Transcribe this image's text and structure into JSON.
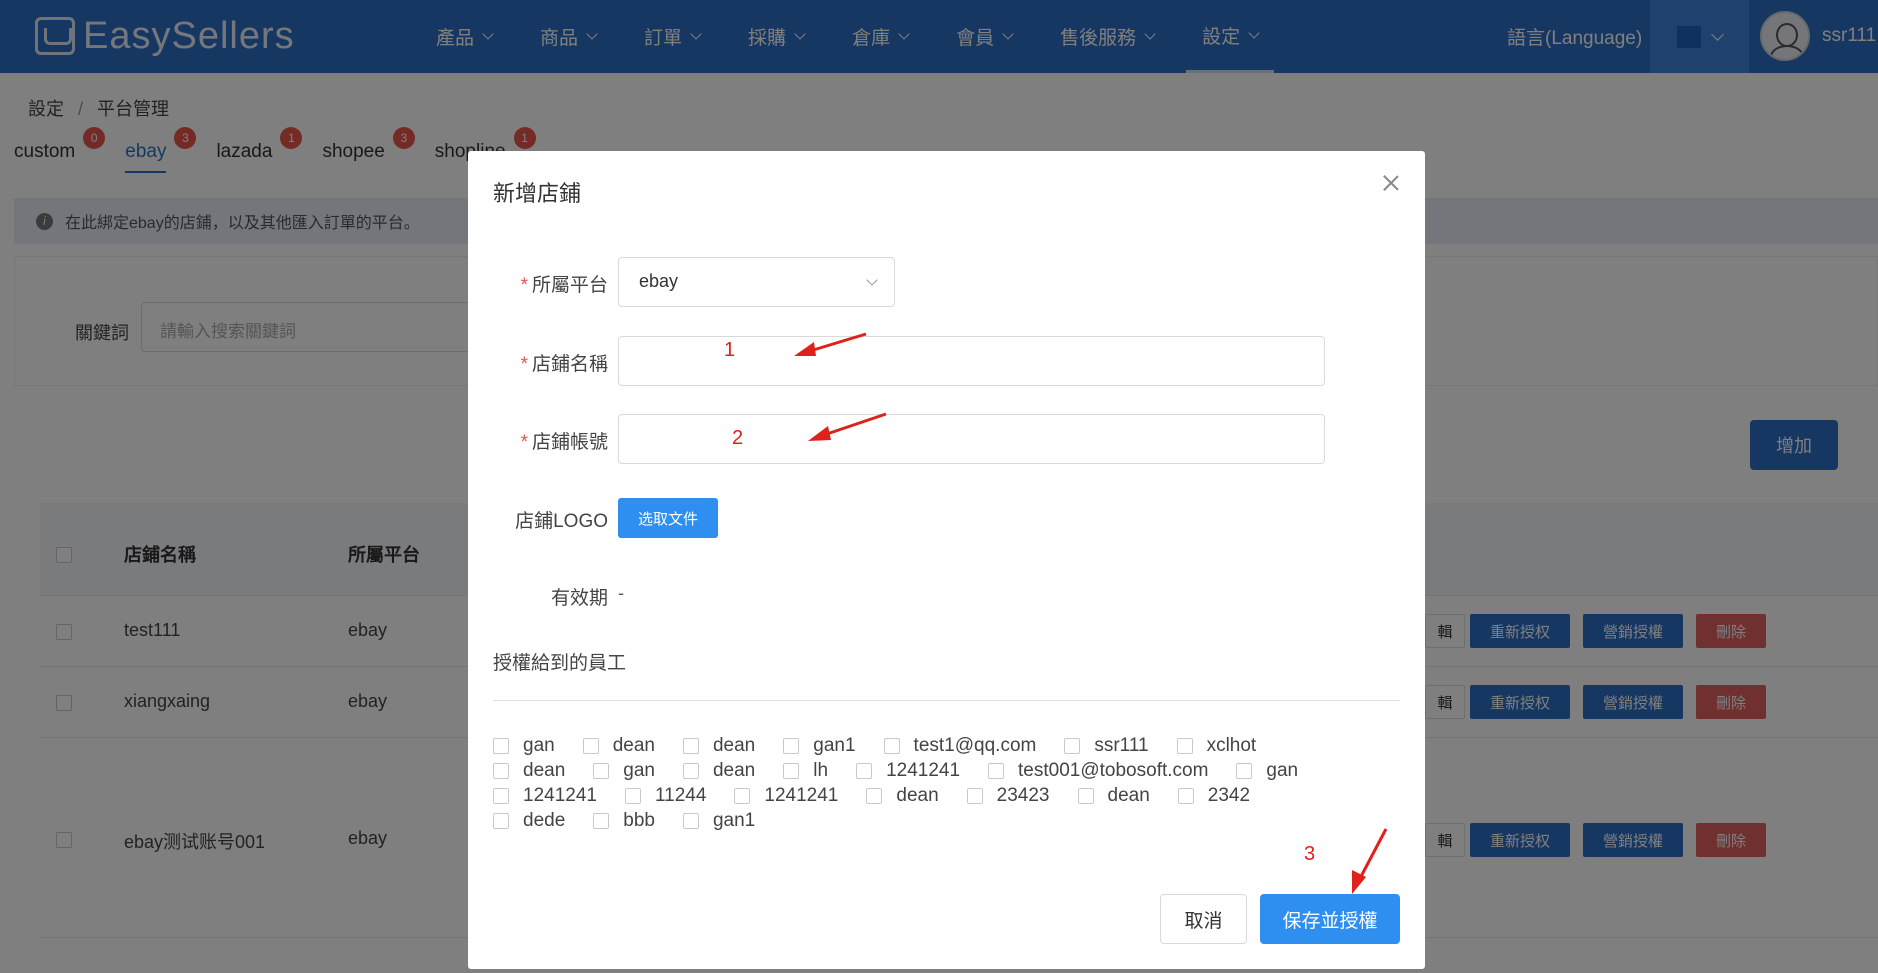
{
  "app": {
    "logo_text": "EasySellers"
  },
  "nav": {
    "items": [
      "產品",
      "商品",
      "訂單",
      "採購",
      "倉庫",
      "會員",
      "售後服務",
      "設定"
    ],
    "language_label": "語言(Language)",
    "user_name": "ssr111"
  },
  "breadcrumb": {
    "root": "設定",
    "separator": "/",
    "current": "平台管理"
  },
  "tabs": [
    {
      "label": "custom",
      "count": "0"
    },
    {
      "label": "ebay",
      "count": "3"
    },
    {
      "label": "lazada",
      "count": "1"
    },
    {
      "label": "shopee",
      "count": "3"
    },
    {
      "label": "shopline",
      "count": "1"
    }
  ],
  "info_text": "在此綁定ebay的店鋪，以及其他匯入訂單的平台。",
  "filter": {
    "keyword_label": "關鍵詞",
    "keyword_placeholder": "請輸入搜索關鍵詞"
  },
  "add_button": "增加",
  "table": {
    "headers": [
      "店鋪名稱",
      "所屬平台"
    ],
    "rows": [
      {
        "store": "test111",
        "platform": "ebay"
      },
      {
        "store": "xiangxaing",
        "platform": "ebay"
      },
      {
        "store": "ebay测试账号001",
        "platform": "ebay"
      }
    ],
    "row_actions": {
      "edit": "輯",
      "reauth": "重新授权",
      "marketing": "營銷授權",
      "delete": "刪除"
    }
  },
  "modal": {
    "title": "新增店鋪",
    "required_mark": "*",
    "platform_label": "所屬平台",
    "platform_value": "ebay",
    "store_name_label": "店鋪名稱",
    "store_account_label": "店鋪帳號",
    "logo_label": "店鋪LOGO",
    "file_button": "选取文件",
    "validity_label": "有效期",
    "validity_value": "-",
    "employees_title": "授權給到的員工",
    "employee_lines": [
      [
        "gan",
        "dean",
        "dean",
        "gan1",
        "test1@qq.com",
        "ssr111",
        "xclhot"
      ],
      [
        "dean",
        "gan",
        "dean",
        "lh",
        "1241241",
        "test001@tobosoft.com",
        "gan"
      ],
      [
        "1241241",
        "11244",
        "1241241",
        "dean",
        "23423",
        "dean",
        "2342"
      ],
      [
        "dede",
        "bbb",
        "gan1"
      ]
    ],
    "cancel_button": "取消",
    "save_button": "保存並授權"
  },
  "annotations": [
    "1",
    "2",
    "3"
  ],
  "colors": {
    "header_blue": "#2f6fc6",
    "primary_blue": "#2f8ff0",
    "danger_red": "#e06060",
    "annotation_red": "#e0201a"
  }
}
